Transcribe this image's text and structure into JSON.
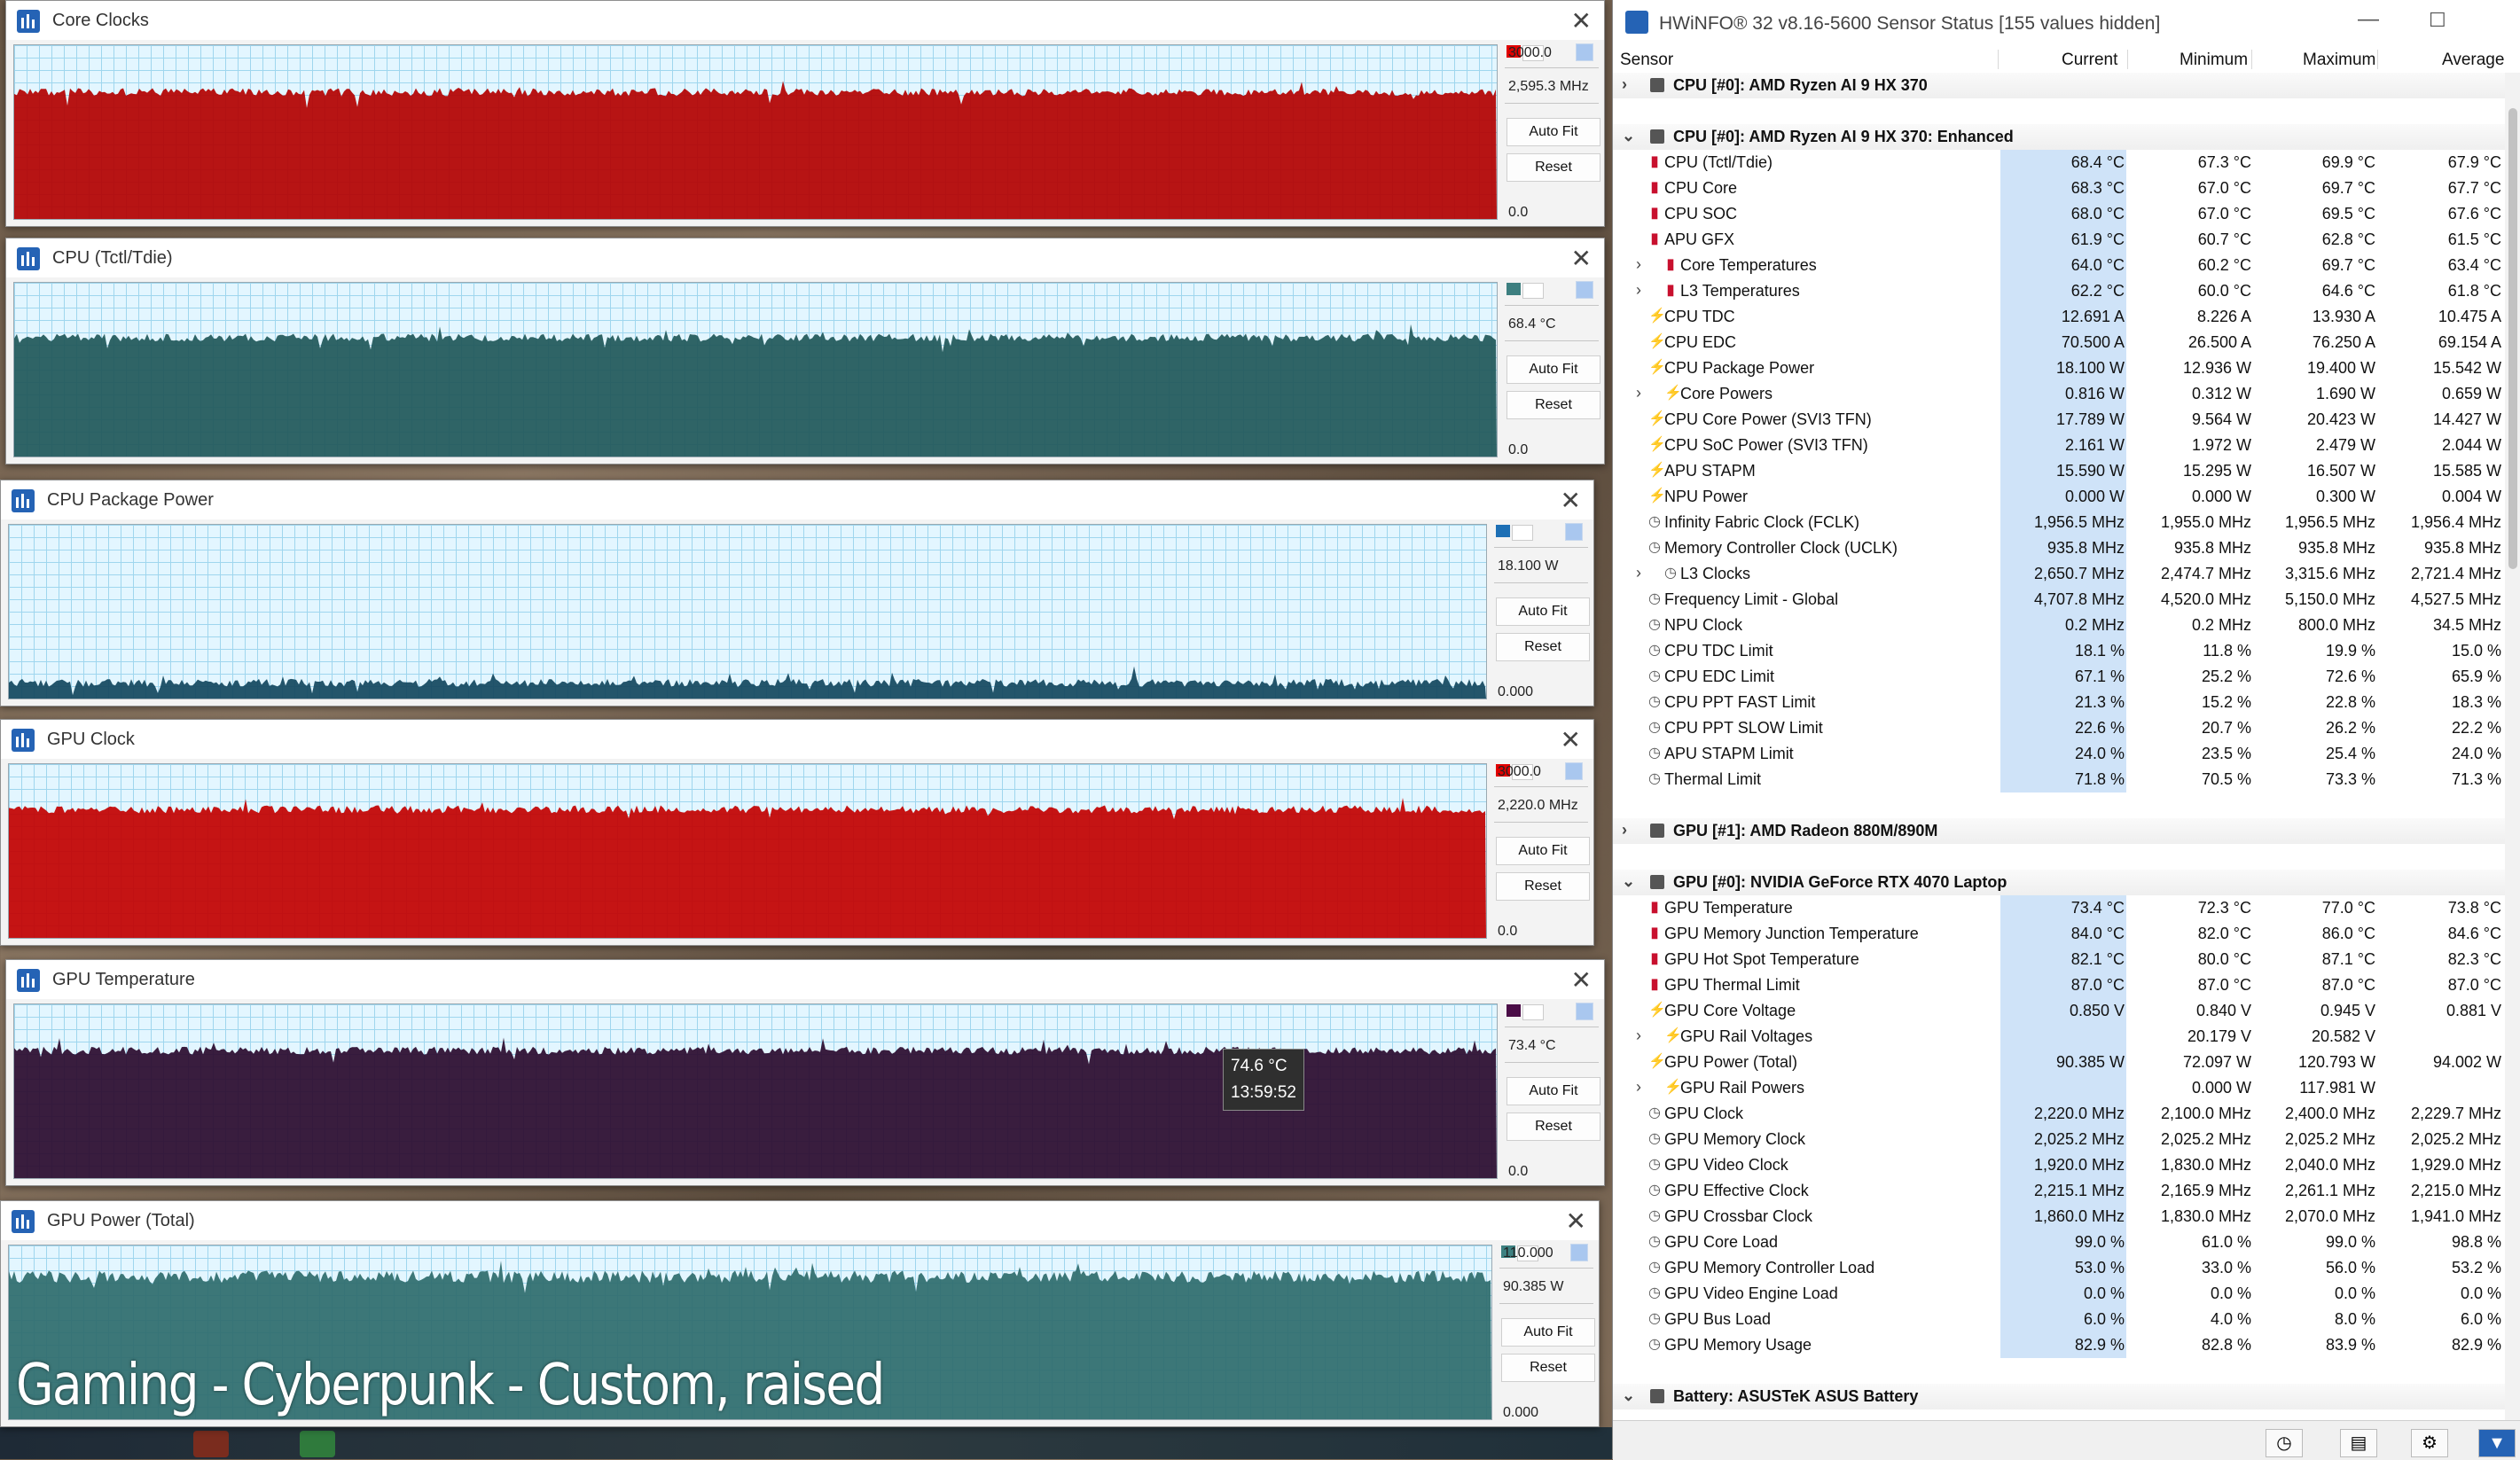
{
  "overlay_caption": "Gaming - Cyberpunk - Custom, raised",
  "graphs": [
    {
      "title": "Core Clocks",
      "max": "3000.0",
      "current": "2,595.3 MHz",
      "min": "0.0",
      "auto_fit": "Auto Fit",
      "reset": "Reset",
      "color": "#b30000",
      "fill_level": 0.73,
      "swatch": "#e00000"
    },
    {
      "title": "CPU (Tctl/Tdie)",
      "max": "",
      "current": "68.4 °C",
      "min": "0.0",
      "auto_fit": "Auto Fit",
      "reset": "Reset",
      "color": "#1f5759",
      "fill_level": 0.684,
      "swatch": "#3d7f80"
    },
    {
      "title": "CPU Package Power",
      "max": "",
      "current": "18.100 W",
      "min": "0.000",
      "auto_fit": "Auto Fit",
      "reset": "Reset",
      "color": "#12465e",
      "fill_level": 0.09,
      "swatch": "#1d6fb5"
    },
    {
      "title": "GPU Clock",
      "max": "3000.0",
      "current": "2,220.0 MHz",
      "min": "0.0",
      "auto_fit": "Auto Fit",
      "reset": "Reset",
      "color": "#c20000",
      "fill_level": 0.74,
      "swatch": "#e00000"
    },
    {
      "title": "GPU Temperature",
      "max": "",
      "current": "73.4 °C",
      "min": "0.0",
      "auto_fit": "Auto Fit",
      "reset": "Reset",
      "color": "#2a0a2e",
      "fill_level": 0.734,
      "swatch": "#4a0d47",
      "tooltip_value": "74.6 °C",
      "tooltip_time": "13:59:52"
    },
    {
      "title": "GPU Power (Total)",
      "max": "110.000",
      "current": "90.385 W",
      "min": "0.000",
      "auto_fit": "Auto Fit",
      "reset": "Reset",
      "color": "#2e6b6c",
      "fill_level": 0.82,
      "swatch": "#3d8080"
    }
  ],
  "hwinfo": {
    "title": "HWiNFO® 32 v8.16-5600 Sensor Status [155 values hidden]",
    "columns": {
      "sensor": "Sensor",
      "current": "Current",
      "minimum": "Minimum",
      "maximum": "Maximum",
      "average": "Average"
    },
    "rows": [
      {
        "type": "group",
        "collapsed": true,
        "name": "CPU [#0]: AMD Ryzen AI 9 HX 370"
      },
      {
        "type": "blank"
      },
      {
        "type": "group",
        "collapsed": false,
        "name": "CPU [#0]: AMD Ryzen AI 9 HX 370: Enhanced"
      },
      {
        "type": "row",
        "icon": "temp",
        "name": "CPU (Tctl/Tdie)",
        "cur": "68.4 °C",
        "min": "67.3 °C",
        "max": "69.9 °C",
        "avg": "67.9 °C"
      },
      {
        "type": "row",
        "icon": "temp",
        "name": "CPU Core",
        "cur": "68.3 °C",
        "min": "67.0 °C",
        "max": "69.7 °C",
        "avg": "67.7 °C"
      },
      {
        "type": "row",
        "icon": "temp",
        "name": "CPU SOC",
        "cur": "68.0 °C",
        "min": "67.0 °C",
        "max": "69.5 °C",
        "avg": "67.6 °C"
      },
      {
        "type": "row",
        "icon": "temp",
        "name": "APU GFX",
        "cur": "61.9 °C",
        "min": "60.7 °C",
        "max": "62.8 °C",
        "avg": "61.5 °C"
      },
      {
        "type": "row",
        "icon": "temp",
        "sub": true,
        "name": "Core Temperatures",
        "cur": "64.0 °C",
        "min": "60.2 °C",
        "max": "69.7 °C",
        "avg": "63.4 °C"
      },
      {
        "type": "row",
        "icon": "temp",
        "sub": true,
        "name": "L3 Temperatures",
        "cur": "62.2 °C",
        "min": "60.0 °C",
        "max": "64.6 °C",
        "avg": "61.8 °C"
      },
      {
        "type": "row",
        "icon": "volt",
        "name": "CPU TDC",
        "cur": "12.691 A",
        "min": "8.226 A",
        "max": "13.930 A",
        "avg": "10.475 A"
      },
      {
        "type": "row",
        "icon": "volt",
        "name": "CPU EDC",
        "cur": "70.500 A",
        "min": "26.500 A",
        "max": "76.250 A",
        "avg": "69.154 A"
      },
      {
        "type": "row",
        "icon": "volt",
        "name": "CPU Package Power",
        "cur": "18.100 W",
        "min": "12.936 W",
        "max": "19.400 W",
        "avg": "15.542 W"
      },
      {
        "type": "row",
        "icon": "volt",
        "sub": true,
        "name": "Core Powers",
        "cur": "0.816 W",
        "min": "0.312 W",
        "max": "1.690 W",
        "avg": "0.659 W"
      },
      {
        "type": "row",
        "icon": "volt",
        "name": "CPU Core Power (SVI3 TFN)",
        "cur": "17.789 W",
        "min": "9.564 W",
        "max": "20.423 W",
        "avg": "14.427 W"
      },
      {
        "type": "row",
        "icon": "volt",
        "name": "CPU SoC Power (SVI3 TFN)",
        "cur": "2.161 W",
        "min": "1.972 W",
        "max": "2.479 W",
        "avg": "2.044 W"
      },
      {
        "type": "row",
        "icon": "volt",
        "name": "APU STAPM",
        "cur": "15.590 W",
        "min": "15.295 W",
        "max": "16.507 W",
        "avg": "15.585 W"
      },
      {
        "type": "row",
        "icon": "volt",
        "name": "NPU Power",
        "cur": "0.000 W",
        "min": "0.000 W",
        "max": "0.300 W",
        "avg": "0.004 W"
      },
      {
        "type": "row",
        "icon": "clk",
        "name": "Infinity Fabric Clock (FCLK)",
        "cur": "1,956.5 MHz",
        "min": "1,955.0 MHz",
        "max": "1,956.5 MHz",
        "avg": "1,956.4 MHz"
      },
      {
        "type": "row",
        "icon": "clk",
        "name": "Memory Controller Clock (UCLK)",
        "cur": "935.8 MHz",
        "min": "935.8 MHz",
        "max": "935.8 MHz",
        "avg": "935.8 MHz"
      },
      {
        "type": "row",
        "icon": "clk",
        "sub": true,
        "name": "L3 Clocks",
        "cur": "2,650.7 MHz",
        "min": "2,474.7 MHz",
        "max": "3,315.6 MHz",
        "avg": "2,721.4 MHz"
      },
      {
        "type": "row",
        "icon": "clk",
        "name": "Frequency Limit - Global",
        "cur": "4,707.8 MHz",
        "min": "4,520.0 MHz",
        "max": "5,150.0 MHz",
        "avg": "4,527.5 MHz"
      },
      {
        "type": "row",
        "icon": "clk",
        "name": "NPU Clock",
        "cur": "0.2 MHz",
        "min": "0.2 MHz",
        "max": "800.0 MHz",
        "avg": "34.5 MHz"
      },
      {
        "type": "row",
        "icon": "clk",
        "name": "CPU TDC Limit",
        "cur": "18.1 %",
        "min": "11.8 %",
        "max": "19.9 %",
        "avg": "15.0 %"
      },
      {
        "type": "row",
        "icon": "clk",
        "name": "CPU EDC Limit",
        "cur": "67.1 %",
        "min": "25.2 %",
        "max": "72.6 %",
        "avg": "65.9 %"
      },
      {
        "type": "row",
        "icon": "clk",
        "name": "CPU PPT FAST Limit",
        "cur": "21.3 %",
        "min": "15.2 %",
        "max": "22.8 %",
        "avg": "18.3 %"
      },
      {
        "type": "row",
        "icon": "clk",
        "name": "CPU PPT SLOW Limit",
        "cur": "22.6 %",
        "min": "20.7 %",
        "max": "26.2 %",
        "avg": "22.2 %"
      },
      {
        "type": "row",
        "icon": "clk",
        "name": "APU STAPM Limit",
        "cur": "24.0 %",
        "min": "23.5 %",
        "max": "25.4 %",
        "avg": "24.0 %"
      },
      {
        "type": "row",
        "icon": "clk",
        "name": "Thermal Limit",
        "cur": "71.8 %",
        "min": "70.5 %",
        "max": "73.3 %",
        "avg": "71.3 %"
      },
      {
        "type": "blank"
      },
      {
        "type": "group",
        "collapsed": true,
        "name": "GPU [#1]: AMD Radeon 880M/890M"
      },
      {
        "type": "blank"
      },
      {
        "type": "group",
        "collapsed": false,
        "name": "GPU [#0]: NVIDIA GeForce RTX 4070 Laptop"
      },
      {
        "type": "row",
        "icon": "temp",
        "name": "GPU Temperature",
        "cur": "73.4 °C",
        "min": "72.3 °C",
        "max": "77.0 °C",
        "avg": "73.8 °C"
      },
      {
        "type": "row",
        "icon": "temp",
        "name": "GPU Memory Junction Temperature",
        "cur": "84.0 °C",
        "min": "82.0 °C",
        "max": "86.0 °C",
        "avg": "84.6 °C"
      },
      {
        "type": "row",
        "icon": "temp",
        "name": "GPU Hot Spot Temperature",
        "cur": "82.1 °C",
        "min": "80.0 °C",
        "max": "87.1 °C",
        "avg": "82.3 °C"
      },
      {
        "type": "row",
        "icon": "temp",
        "name": "GPU Thermal Limit",
        "cur": "87.0 °C",
        "min": "87.0 °C",
        "max": "87.0 °C",
        "avg": "87.0 °C"
      },
      {
        "type": "row",
        "icon": "volt",
        "name": "GPU Core Voltage",
        "cur": "0.850 V",
        "min": "0.840 V",
        "max": "0.945 V",
        "avg": "0.881 V"
      },
      {
        "type": "row",
        "icon": "volt",
        "sub": true,
        "name": "GPU Rail Voltages",
        "cur": "",
        "min": "20.179 V",
        "max": "20.582 V",
        "avg": ""
      },
      {
        "type": "row",
        "icon": "volt",
        "name": "GPU Power (Total)",
        "cur": "90.385 W",
        "min": "72.097 W",
        "max": "120.793 W",
        "avg": "94.002 W"
      },
      {
        "type": "row",
        "icon": "volt",
        "sub": true,
        "name": "GPU Rail Powers",
        "cur": "",
        "min": "0.000 W",
        "max": "117.981 W",
        "avg": ""
      },
      {
        "type": "row",
        "icon": "clk",
        "name": "GPU Clock",
        "cur": "2,220.0 MHz",
        "min": "2,100.0 MHz",
        "max": "2,400.0 MHz",
        "avg": "2,229.7 MHz"
      },
      {
        "type": "row",
        "icon": "clk",
        "name": "GPU Memory Clock",
        "cur": "2,025.2 MHz",
        "min": "2,025.2 MHz",
        "max": "2,025.2 MHz",
        "avg": "2,025.2 MHz"
      },
      {
        "type": "row",
        "icon": "clk",
        "name": "GPU Video Clock",
        "cur": "1,920.0 MHz",
        "min": "1,830.0 MHz",
        "max": "2,040.0 MHz",
        "avg": "1,929.0 MHz"
      },
      {
        "type": "row",
        "icon": "clk",
        "name": "GPU Effective Clock",
        "cur": "2,215.1 MHz",
        "min": "2,165.9 MHz",
        "max": "2,261.1 MHz",
        "avg": "2,215.0 MHz"
      },
      {
        "type": "row",
        "icon": "clk",
        "name": "GPU Crossbar Clock",
        "cur": "1,860.0 MHz",
        "min": "1,830.0 MHz",
        "max": "2,070.0 MHz",
        "avg": "1,941.0 MHz"
      },
      {
        "type": "row",
        "icon": "clk",
        "name": "GPU Core Load",
        "cur": "99.0 %",
        "min": "61.0 %",
        "max": "99.0 %",
        "avg": "98.8 %"
      },
      {
        "type": "row",
        "icon": "clk",
        "name": "GPU Memory Controller Load",
        "cur": "53.0 %",
        "min": "33.0 %",
        "max": "56.0 %",
        "avg": "53.2 %"
      },
      {
        "type": "row",
        "icon": "clk",
        "name": "GPU Video Engine Load",
        "cur": "0.0 %",
        "min": "0.0 %",
        "max": "0.0 %",
        "avg": "0.0 %"
      },
      {
        "type": "row",
        "icon": "clk",
        "name": "GPU Bus Load",
        "cur": "6.0 %",
        "min": "4.0 %",
        "max": "8.0 %",
        "avg": "6.0 %"
      },
      {
        "type": "row",
        "icon": "clk",
        "name": "GPU Memory Usage",
        "cur": "82.9 %",
        "min": "82.8 %",
        "max": "83.9 %",
        "avg": "82.9 %"
      },
      {
        "type": "blank"
      },
      {
        "type": "group",
        "collapsed": false,
        "name": "Battery: ASUSTeK ASUS Battery"
      }
    ]
  }
}
